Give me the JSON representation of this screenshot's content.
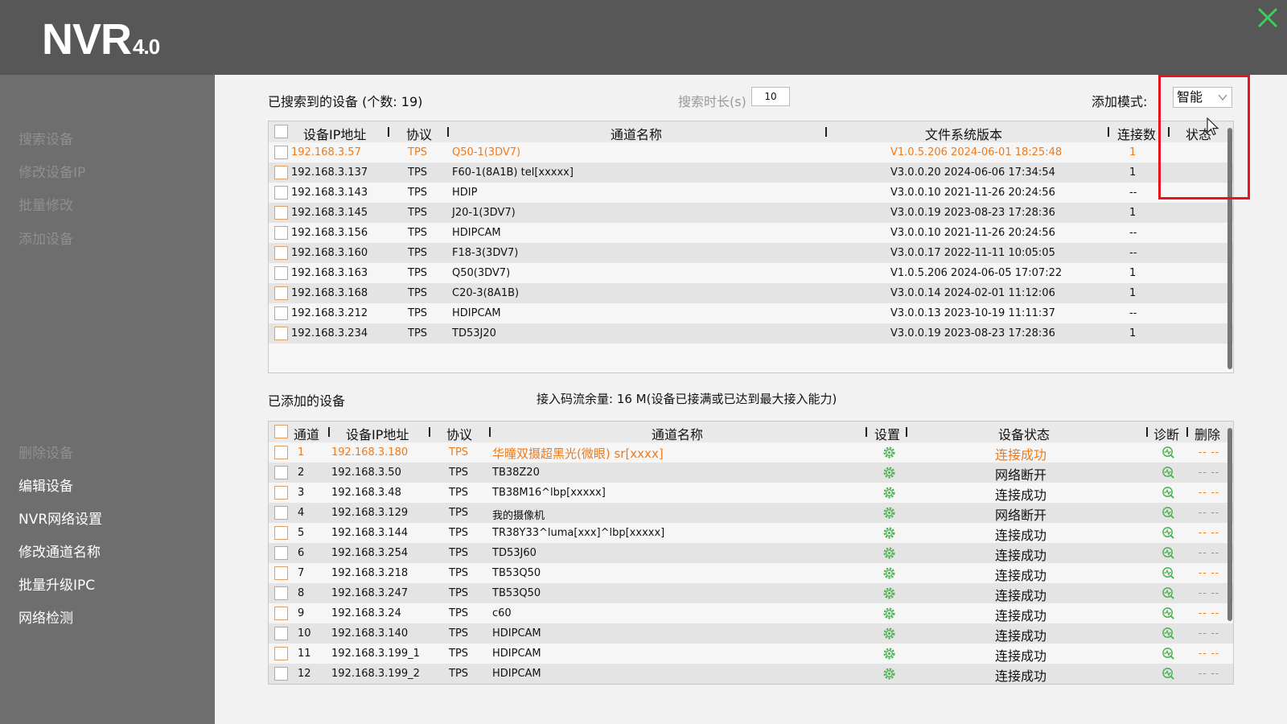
{
  "app": {
    "logo_main": "NVR",
    "logo_version": "4.0"
  },
  "sidebar": {
    "items_top": [
      "搜索设备",
      "修改设备IP",
      "批量修改",
      "添加设备"
    ],
    "items_bottom": [
      "删除设备",
      "编辑设备",
      "NVR网络设置",
      "修改通道名称",
      "批量升级IPC",
      "网络检测"
    ]
  },
  "searched": {
    "title": "已搜索到的设备 (个数: 19)",
    "duration_label": "搜索时长(s)",
    "duration_value": "10",
    "add_mode_label": "添加模式:",
    "add_mode_value": "智能",
    "columns": [
      "设备IP地址",
      "协议",
      "通道名称",
      "文件系统版本",
      "连接数",
      "状态"
    ],
    "rows": [
      [
        "192.168.3.57",
        "TPS",
        "Q50-1(3DV7)",
        "V1.0.5.206 2024-06-01 18:25:48",
        "1"
      ],
      [
        "192.168.3.137",
        "TPS",
        "F60-1(8A1B) tel[xxxxx]",
        "V3.0.0.20 2024-06-06 17:34:54",
        "1"
      ],
      [
        "192.168.3.143",
        "TPS",
        "HDIP",
        "V3.0.0.10 2021-11-26 20:24:56",
        "--"
      ],
      [
        "192.168.3.145",
        "TPS",
        "J20-1(3DV7)",
        "V3.0.0.19 2023-08-23 17:28:36",
        "1"
      ],
      [
        "192.168.3.156",
        "TPS",
        "HDIPCAM",
        "V3.0.0.10 2021-11-26 20:24:56",
        "--"
      ],
      [
        "192.168.3.160",
        "TPS",
        "F18-3(3DV7)",
        "V3.0.0.17 2022-11-11 10:05:05",
        "--"
      ],
      [
        "192.168.3.163",
        "TPS",
        "Q50(3DV7)",
        "V1.0.5.206 2024-06-05 17:07:22",
        "1"
      ],
      [
        "192.168.3.168",
        "TPS",
        "C20-3(8A1B)",
        "V3.0.0.14 2024-02-01 11:12:06",
        "1"
      ],
      [
        "192.168.3.212",
        "TPS",
        "HDIPCAM",
        "V3.0.0.13 2023-10-19 11:11:37",
        "--"
      ],
      [
        "192.168.3.234",
        "TPS",
        "TD53J20",
        "V3.0.0.19 2023-08-23 17:28:36",
        "1"
      ]
    ]
  },
  "added": {
    "title": "已添加的设备",
    "bandwidth_note": "接入码流余量: 16 M(设备已接满或已达到最大接入能力)",
    "columns": [
      "通道",
      "设备IP地址",
      "协议",
      "通道名称",
      "设置",
      "设备状态",
      "诊断",
      "删除"
    ],
    "delete_text": "-- --",
    "rows": [
      [
        "1",
        "192.168.3.180",
        "TPS",
        "华曈双摄超黑光(微眼) sr[xxxx]",
        "连接成功"
      ],
      [
        "2",
        "192.168.3.50",
        "TPS",
        "TB38Z20",
        "网络断开"
      ],
      [
        "3",
        "192.168.3.48",
        "TPS",
        "TB38M16^lbp[xxxxx]",
        "连接成功"
      ],
      [
        "4",
        "192.168.3.129",
        "TPS",
        "我的摄像机",
        "网络断开"
      ],
      [
        "5",
        "192.168.3.144",
        "TPS",
        "TR38Y33^luma[xxx]^lbp[xxxxx]",
        "连接成功"
      ],
      [
        "6",
        "192.168.3.254",
        "TPS",
        "TD53J60",
        "连接成功"
      ],
      [
        "7",
        "192.168.3.218",
        "TPS",
        "TB53Q50",
        "连接成功"
      ],
      [
        "8",
        "192.168.3.247",
        "TPS",
        "TB53Q50",
        "连接成功"
      ],
      [
        "9",
        "192.168.3.24",
        "TPS",
        "c60",
        "连接成功"
      ],
      [
        "10",
        "192.168.3.140",
        "TPS",
        "HDIPCAM",
        "连接成功"
      ],
      [
        "11",
        "192.168.3.199_1",
        "TPS",
        "HDIPCAM",
        "连接成功"
      ],
      [
        "12",
        "192.168.3.199_2",
        "TPS",
        "HDIPCAM",
        "连接成功"
      ]
    ]
  },
  "colors": {
    "highlight": "#f07a18",
    "icon_green": "#4caf50",
    "annotation_red": "#e8141b",
    "close_green": "#3ecf5a"
  },
  "icons": {
    "close": "close-icon",
    "gear": "gear-icon",
    "diagnose": "diagnose-icon",
    "dropdown": "chevron-down-icon"
  }
}
